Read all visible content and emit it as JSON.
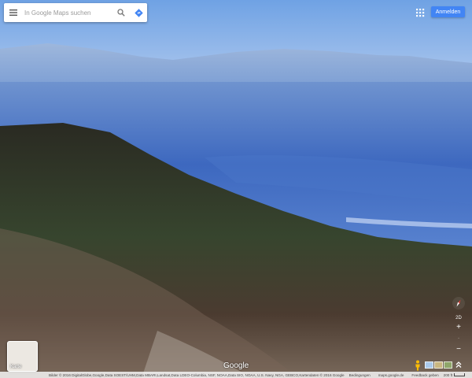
{
  "search": {
    "placeholder": "In Google Maps suchen"
  },
  "icons": {
    "menu": "hamburger-menu-icon",
    "search": "magnifier-icon",
    "directions": "directions-diamond-icon",
    "apps": "app-grid-icon",
    "compass": "compass-needle-icon",
    "pegman": "pegman-icon",
    "expand": "chevron-up-double-icon"
  },
  "header": {
    "signin_label": "Anmelden"
  },
  "layer_switch": {
    "label": "Karte"
  },
  "branding": {
    "logo": "Google"
  },
  "controls": {
    "tilt_label": "2D",
    "zoom_in": "+",
    "zoom_out": "−"
  },
  "footer": {
    "imagery": "Bilder © 2016 DigitalGlobe,Google,Data SOEST/UHM,Data MBARI,Landsat,Data LDEO-Columbia, NSF, NOAA,Data SIO, NOAA, U.S. Navy, NGA, GEBCO,Kartendaten © 2016 Google",
    "terms": "Bedingungen",
    "site": "maps.google.de",
    "feedback": "Feedback geben",
    "scale": "200 ft"
  },
  "colors": {
    "accent": "#4285f4",
    "sky": "#8fb4e6",
    "ocean": "#3d6cc0",
    "terrain": "#2f3a2a"
  }
}
